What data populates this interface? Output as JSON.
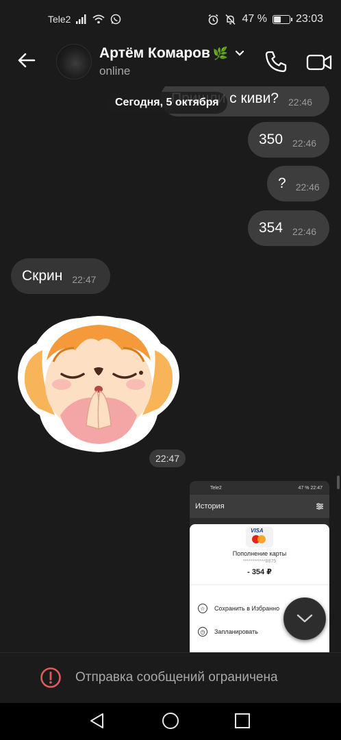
{
  "status_bar": {
    "carrier": "Tele2",
    "battery": "47 %",
    "battery_level": 0.47,
    "time": "23:03",
    "icons": [
      "signal-icon",
      "wifi-icon",
      "whatsapp-icon",
      "alarm-icon",
      "mute-icon",
      "battery-icon"
    ]
  },
  "header": {
    "contact_name": "Артём Комаров",
    "name_emoji": "🌿",
    "status": "online",
    "icons": [
      "back-arrow-icon",
      "chevron-down-icon",
      "phone-icon",
      "video-camera-icon"
    ]
  },
  "chat": {
    "date_label": "Сегодня, 5 октября",
    "messages": [
      {
        "direction": "out",
        "text": "Пришли с киви?",
        "time": "22:46"
      },
      {
        "direction": "out",
        "text": "350",
        "time": "22:46"
      },
      {
        "direction": "out",
        "text": "?",
        "time": "22:46"
      },
      {
        "direction": "out",
        "text": "354",
        "time": "22:46"
      },
      {
        "direction": "in",
        "text": "Скрин",
        "time": "22:47"
      }
    ],
    "sticker": {
      "time": "22:47"
    }
  },
  "screenshot_preview": {
    "status_carrier": "Tele2",
    "status_battery": "47 %",
    "status_time": "22:47",
    "header_title": "История",
    "card_brand": "VISA",
    "card_title": "Пополнение карты",
    "card_number": "************8875",
    "amount": "- 354 ₽",
    "actions": [
      {
        "label": "Сохранить в Избранно",
        "icon": "star-icon"
      },
      {
        "label": "Запланировать",
        "icon": "clock-icon"
      }
    ]
  },
  "restricted_notice": {
    "text": "Отправка сообщений ограничена",
    "icon": "warning-circle-icon",
    "color": "#e05a5a"
  },
  "nav_bar": {
    "icons": [
      "nav-back-icon",
      "nav-home-icon",
      "nav-recent-icon"
    ]
  }
}
